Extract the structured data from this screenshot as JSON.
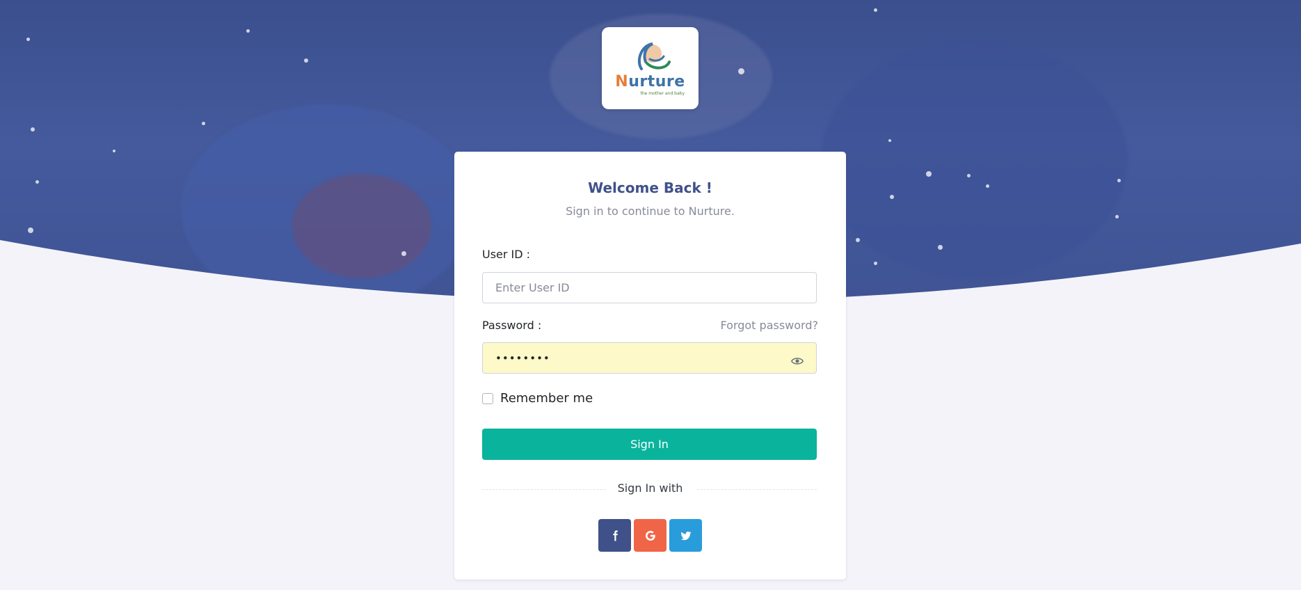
{
  "brand": {
    "name": "Nurture",
    "tagline": "the mother and baby"
  },
  "card": {
    "title": "Welcome Back !",
    "subtitle": "Sign in to continue to Nurture."
  },
  "fields": {
    "user_id": {
      "label": "User ID :",
      "placeholder": "Enter User ID",
      "value": ""
    },
    "password": {
      "label": "Password :",
      "masked_value": "••••••••",
      "forgot_label": "Forgot password?"
    }
  },
  "remember_label": "Remember me",
  "signin_label": "Sign In",
  "signin_with_label": "Sign In with",
  "socials": [
    {
      "name": "facebook",
      "icon": "facebook-icon",
      "color": "#405189"
    },
    {
      "name": "google",
      "icon": "google-icon",
      "color": "#f06548"
    },
    {
      "name": "twitter",
      "icon": "twitter-icon",
      "color": "#299cdb"
    }
  ],
  "colors": {
    "primary": "#405189",
    "success": "#0ab39c",
    "background": "#f3f3f9"
  }
}
